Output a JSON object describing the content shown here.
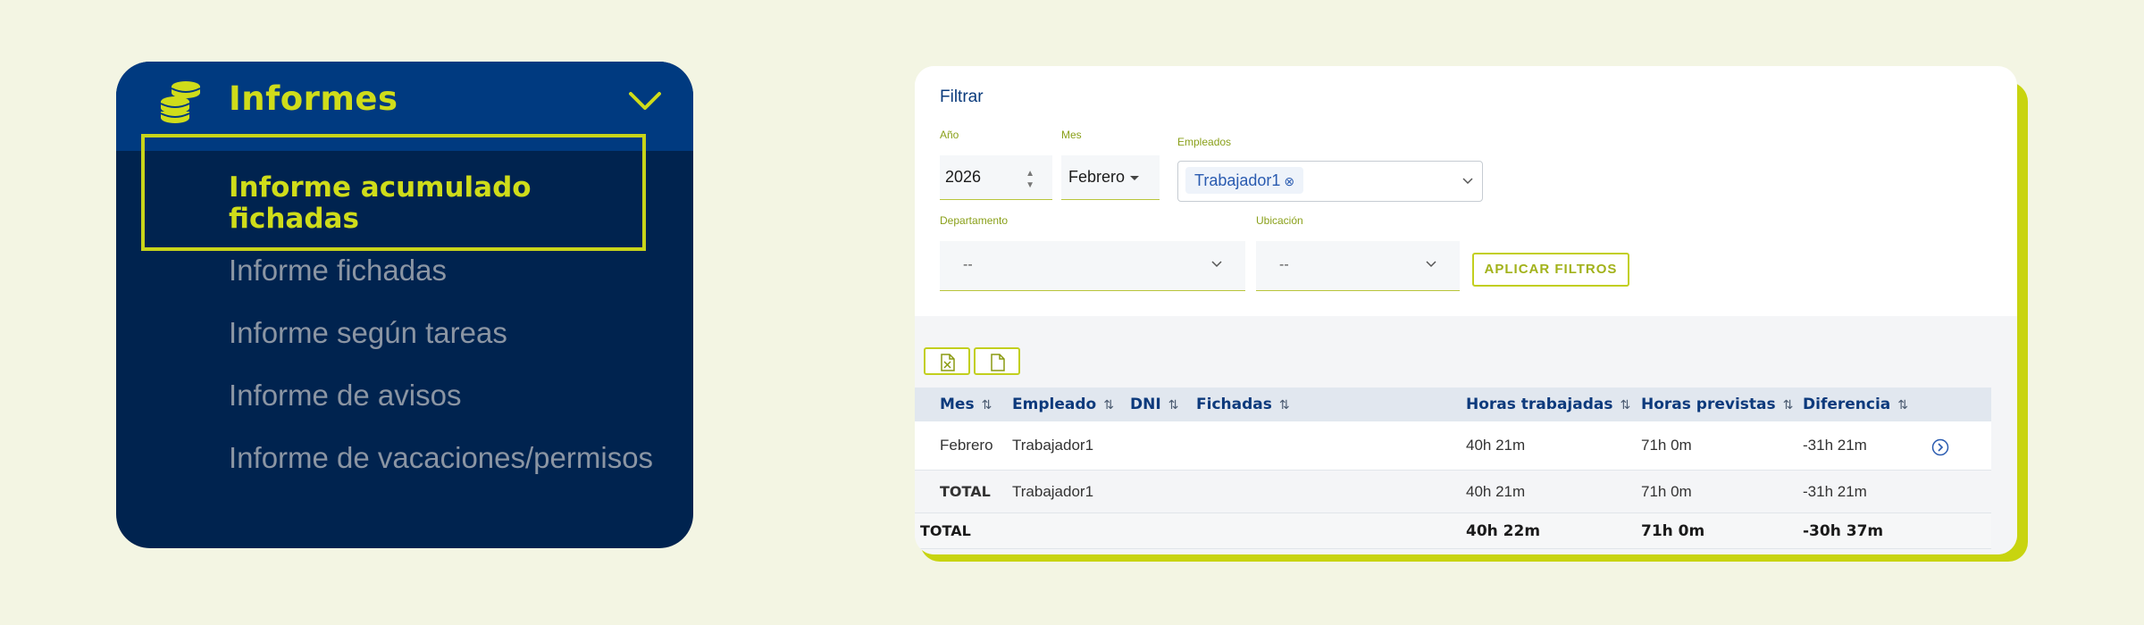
{
  "menu": {
    "title": "Informes",
    "selected_item": "Informe acumulado fichadas",
    "items": [
      "Informe fichadas",
      "Informe según tareas",
      "Informe de avisos",
      "Informe de vacaciones/permisos"
    ],
    "icon": "coins-stack-icon",
    "accent": "#cfdc1a",
    "background": "#00234f"
  },
  "filter": {
    "title": "Filtrar",
    "year_label": "Año",
    "year_value": "2026",
    "month_label": "Mes",
    "month_value": "Febrero",
    "employees_label": "Empleados",
    "employee_chip": "Trabajador1",
    "chip_remove_glyph": "⊗",
    "department_label": "Departamento",
    "department_value": "--",
    "location_label": "Ubicación",
    "location_value": "--",
    "apply_label": "APLICAR FILTROS"
  },
  "export": {
    "excel_icon": "excel-file-icon",
    "pdf_icon": "file-icon"
  },
  "table": {
    "sort_glyph": "⇅",
    "headers": {
      "mes": "Mes",
      "empleado": "Empleado",
      "dni": "DNI",
      "fichadas": "Fichadas",
      "horas_trabajadas": "Horas trabajadas",
      "horas_previstas": "Horas previstas",
      "diferencia": "Diferencia"
    },
    "rows": [
      {
        "mes": "Febrero",
        "empleado": "Trabajador1",
        "horas_trabajadas": "40h 21m",
        "horas_previstas": "71h 0m",
        "diferencia": "-31h 21m"
      },
      {
        "mes": "TOTAL",
        "empleado": "Trabajador1",
        "horas_trabajadas": "40h 21m",
        "horas_previstas": "71h 0m",
        "diferencia": "-31h 21m"
      }
    ],
    "grand_total": {
      "label": "TOTAL",
      "horas_trabajadas": "40h 22m",
      "horas_previstas": "71h 0m",
      "diferencia": "-30h 37m"
    }
  }
}
